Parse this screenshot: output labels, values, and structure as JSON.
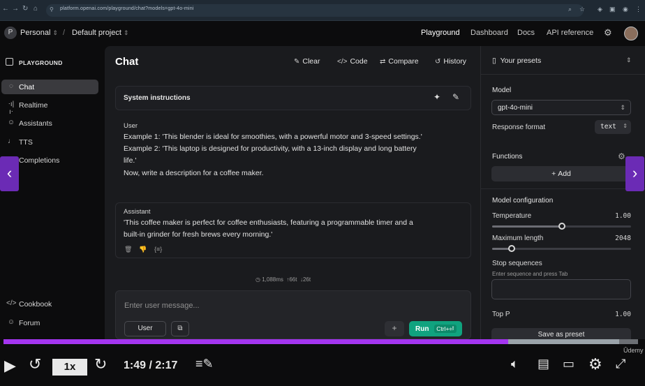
{
  "browser": {
    "url": "platform.openai.com/playground/chat?models=gpt-4o-mini"
  },
  "appbar": {
    "org_initial": "P",
    "org": "Personal",
    "separator": "/",
    "project": "Default project",
    "nav": [
      "Playground",
      "Dashboard",
      "Docs",
      "API reference"
    ]
  },
  "sidebar": {
    "section": "PLAYGROUND",
    "items": [
      {
        "label": "Chat",
        "icon": "chat-bubble-icon"
      },
      {
        "label": "Realtime",
        "icon": "waveform-icon"
      },
      {
        "label": "Assistants",
        "icon": "people-icon"
      },
      {
        "label": "TTS",
        "icon": "microphone-icon"
      },
      {
        "label": "Completions",
        "icon": "text-lines-icon"
      }
    ],
    "bottom": [
      {
        "label": "Cookbook",
        "icon": "code-icon"
      },
      {
        "label": "Forum",
        "icon": "people-icon"
      }
    ]
  },
  "main": {
    "title": "Chat",
    "actions": {
      "clear": "Clear",
      "code": "Code",
      "compare": "Compare",
      "history": "History"
    },
    "system": {
      "label": "System instructions"
    },
    "user": {
      "role": "User",
      "line1": "Example 1: 'This blender is ideal for smoothies, with a powerful motor and 3-speed settings.'",
      "line2": "Example 2: 'This laptop is designed for productivity, with a 13-inch display and long battery",
      "line3": "life.'",
      "line4": "Now, write a description for a coffee maker."
    },
    "assistant": {
      "role": "Assistant",
      "line1": "'This coffee maker is perfect for coffee enthusiasts, featuring a programmable timer and a",
      "line2": "built-in grinder for fresh brews every morning.'"
    },
    "stats": {
      "time": "1,088ms",
      "in": "66t",
      "out": "26t"
    },
    "composer": {
      "placeholder": "Enter user message...",
      "role_button": "User",
      "run": "Run",
      "shortcut": "Ctrl+⏎"
    }
  },
  "right": {
    "presets": "Your presets",
    "model_label": "Model",
    "model": "gpt-4o-mini",
    "response_format_label": "Response format",
    "response_format": "text",
    "functions_label": "Functions",
    "add": "Add",
    "config_label": "Model configuration",
    "temperature_label": "Temperature",
    "temperature": "1.00",
    "temperature_fraction": 0.5,
    "max_length_label": "Maximum length",
    "max_length": "2048",
    "max_length_fraction": 0.14,
    "stop_label": "Stop sequences",
    "stop_hint": "Enter sequence and press Tab",
    "top_p_label": "Top P",
    "top_p": "1.00",
    "save": "Save as preset"
  },
  "player": {
    "speed": "1x",
    "time": "1:49 / 2:17",
    "played_fraction": 0.795,
    "buffered_fraction": 0.97,
    "brand": "Ūdemy"
  },
  "colors": {
    "accent_purple": "#a435f0",
    "run_green": "#10a37f",
    "arrow_purple": "#6b2bb5"
  }
}
